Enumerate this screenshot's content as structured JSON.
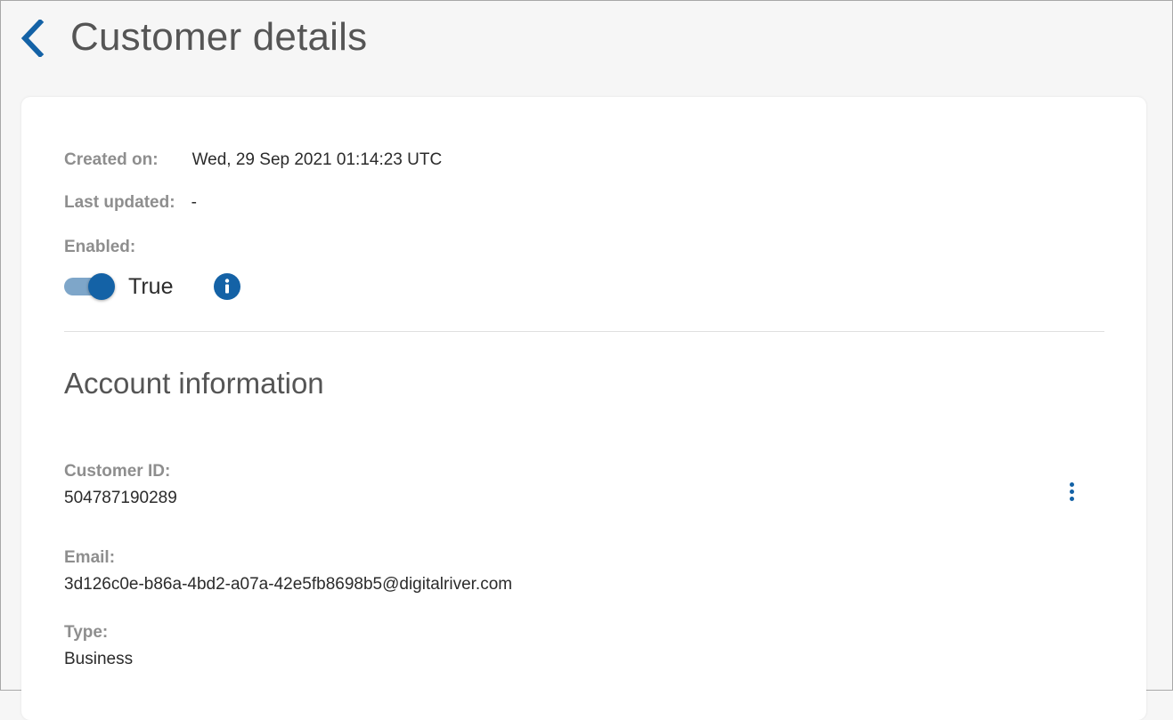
{
  "header": {
    "title": "Customer details"
  },
  "summary": {
    "created_label": "Created on:",
    "created_value": "Wed, 29 Sep 2021 01:14:23 UTC",
    "updated_label": "Last updated:",
    "updated_value": "-",
    "enabled_label": "Enabled:",
    "enabled_value": "True",
    "enabled_on": true
  },
  "account": {
    "title": "Account information",
    "customer_id_label": "Customer ID:",
    "customer_id_value": "504787190289",
    "email_label": "Email:",
    "email_value": "3d126c0e-b86a-4bd2-a07a-42e5fb8698b5@digitalriver.com",
    "type_label": "Type:",
    "type_value": "Business"
  },
  "icons": {
    "back": "chevron-left-icon",
    "info": "info-icon",
    "more": "more-vertical-icon"
  },
  "colors": {
    "accent": "#1462a6",
    "toggle_track": "#7ea6c9",
    "label": "#8e8e8e",
    "title": "#555555"
  }
}
